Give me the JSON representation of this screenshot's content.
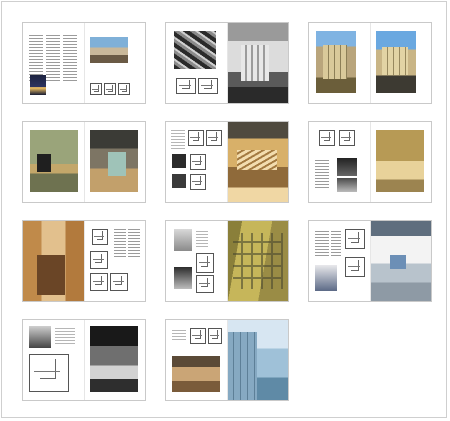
{
  "page": {
    "title": "",
    "spreads": [
      {
        "id": "spread-1",
        "layout": "text-photo"
      },
      {
        "id": "spread-2",
        "layout": "photo-photo"
      },
      {
        "id": "spread-3",
        "layout": "photo-photo"
      },
      {
        "id": "spread-4",
        "layout": "photo-photo"
      },
      {
        "id": "spread-5",
        "layout": "plans-photo"
      },
      {
        "id": "spread-6",
        "layout": "plans-photo"
      },
      {
        "id": "spread-7",
        "layout": "photo-plans"
      },
      {
        "id": "spread-8",
        "layout": "plans-photo"
      },
      {
        "id": "spread-9",
        "layout": "text-photo"
      },
      {
        "id": "spread-10",
        "layout": "drawing-photo"
      },
      {
        "id": "spread-11",
        "layout": "photo-photo"
      }
    ]
  }
}
